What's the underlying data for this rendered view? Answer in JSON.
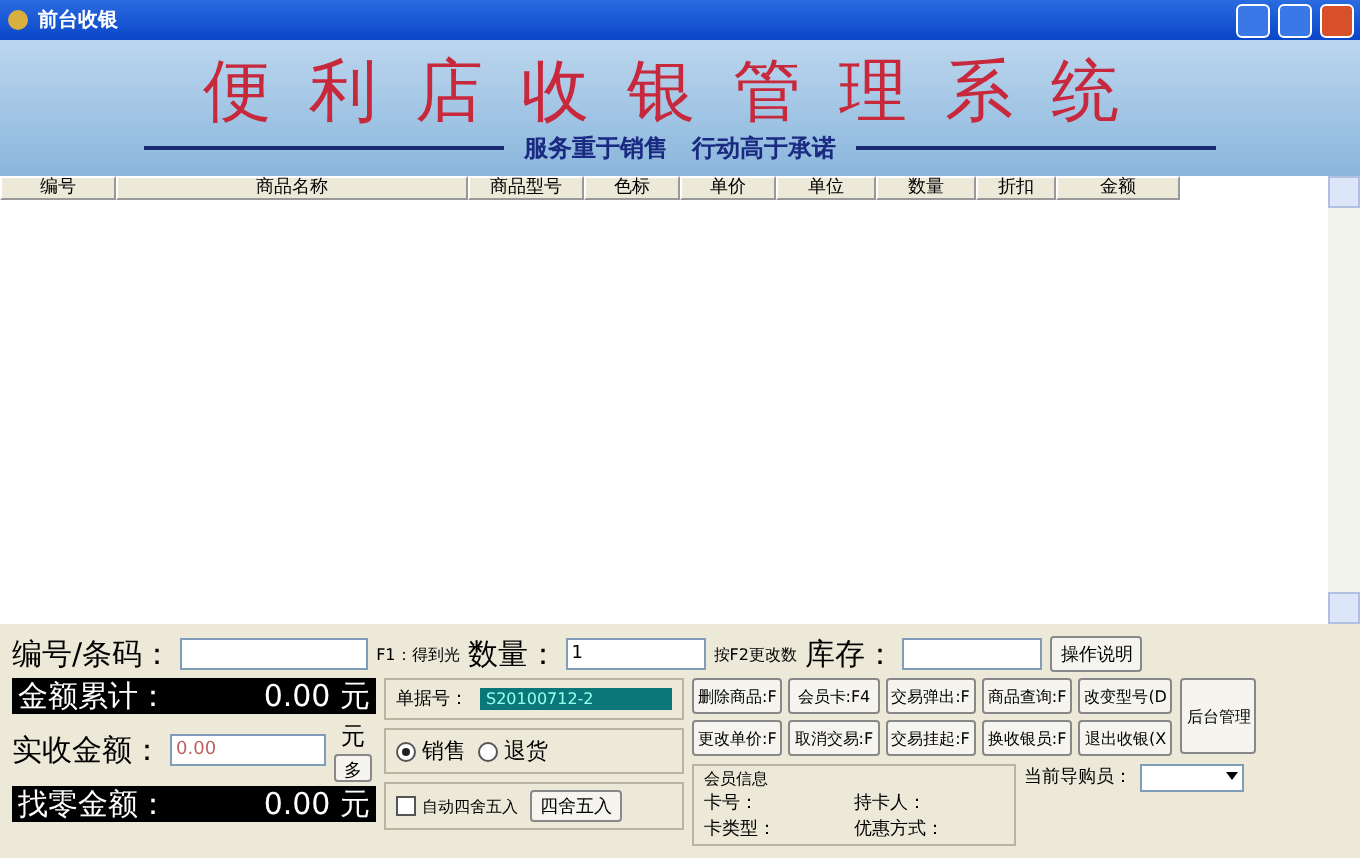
{
  "window": {
    "title": "前台收银"
  },
  "banner": {
    "title": "便利店收银管理系统",
    "slogan": "服务重于销售　行动高于承诺"
  },
  "table": {
    "columns": [
      "编号",
      "商品名称",
      "商品型号",
      "色标",
      "单价",
      "单位",
      "数量",
      "折扣",
      "金额"
    ]
  },
  "entry": {
    "code_label": "编号/条码：",
    "code_hint": "F1：得到光",
    "qty_label": "数量：",
    "qty_value": "1",
    "qty_hint": "按F2更改数",
    "stock_label": "库存：",
    "help_button": "操作说明"
  },
  "totals": [
    {
      "label": "金额累计：",
      "value": "0.00 元"
    },
    {
      "label": "找零金额：",
      "value": "0.00 元"
    }
  ],
  "received": {
    "label": "实收金额：",
    "value": "0.00",
    "unit": "元",
    "more_button": "多"
  },
  "receipt": {
    "label": "单据号：",
    "value": "S20100712-2"
  },
  "modes": [
    {
      "label": "销售",
      "selected": true
    },
    {
      "label": "退货",
      "selected": false
    }
  ],
  "rounding": {
    "auto_label": "自动四舍五入",
    "auto_checked": false,
    "button": "四舍五入"
  },
  "buttons": [
    [
      "删除商品:F",
      "会员卡:F4",
      "交易弹出:F",
      "商品查询:F",
      "改变型号(D"
    ],
    [
      "更改单价:F",
      "取消交易:F",
      "交易挂起:F",
      "换收银员:F",
      "退出收银(X"
    ]
  ],
  "admin_button": "后台管理",
  "member": {
    "title": "会员信息",
    "fields": [
      "卡号：",
      "持卡人：",
      "卡类型：",
      "优惠方式："
    ]
  },
  "guide": {
    "label": "当前导购员："
  }
}
